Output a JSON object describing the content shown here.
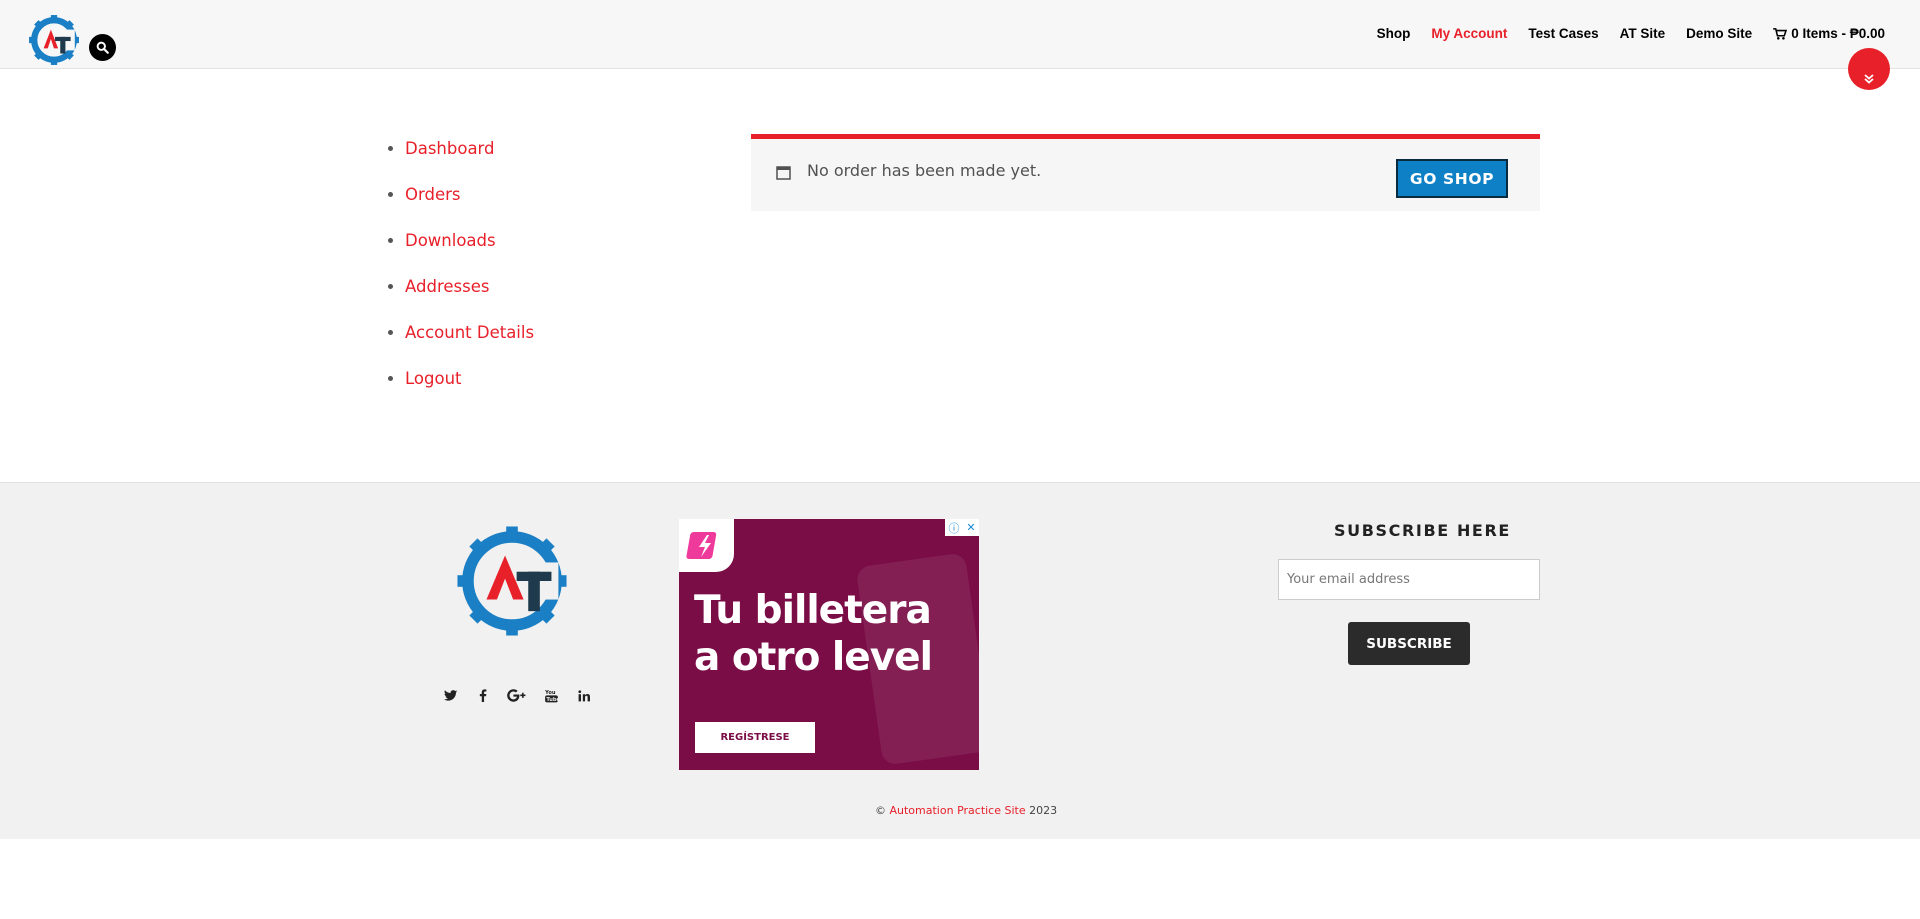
{
  "header": {
    "nav": [
      {
        "label": "Shop",
        "active": false
      },
      {
        "label": "My Account",
        "active": true
      },
      {
        "label": "Test Cases",
        "active": false
      },
      {
        "label": "AT Site",
        "active": false
      },
      {
        "label": "Demo Site",
        "active": false
      }
    ],
    "cart_label": "0 Items - ₱0.00",
    "logo_letters": "AT"
  },
  "account_nav": [
    "Dashboard",
    "Orders",
    "Downloads",
    "Addresses",
    "Account Details",
    "Logout"
  ],
  "notice": {
    "message": "No order has been made yet.",
    "button_label": "GO SHOP"
  },
  "footer": {
    "social_icons": [
      "twitter-icon",
      "facebook-icon",
      "google-plus-icon",
      "youtube-icon",
      "linkedin-icon"
    ],
    "ad": {
      "headline_line1": "Tu billetera",
      "headline_line2": "a otro level",
      "cta": "REGÍSTRESE"
    },
    "subscribe": {
      "title": "SUBSCRIBE HERE",
      "placeholder": "Your email address",
      "button_label": "SUBSCRIBE"
    },
    "copyright": {
      "prefix": "©",
      "link": "Automation Practice Site",
      "year": "2023"
    }
  },
  "colors": {
    "accent": "#e8202a",
    "button_blue": "#0e80c6",
    "logo_blue": "#1a7fc4",
    "logo_navy": "#1e3a4c",
    "ad_bg": "#7a0c46"
  }
}
